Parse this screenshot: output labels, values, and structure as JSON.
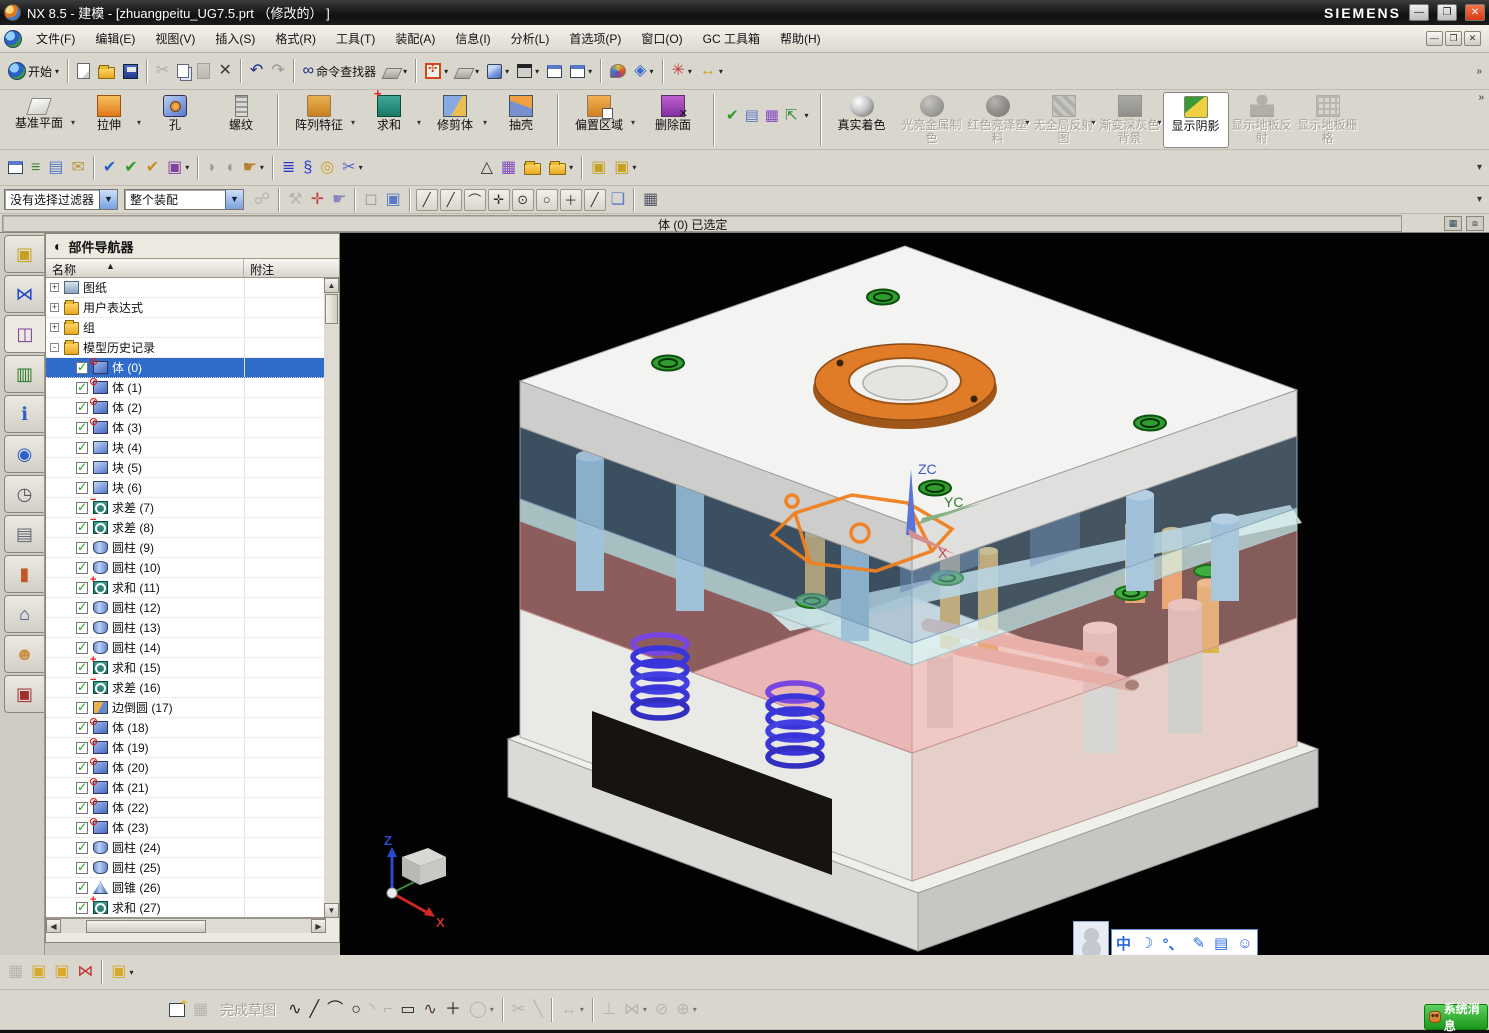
{
  "window": {
    "title": "NX 8.5 - 建模 - [zhuangpeitu_UG7.5.prt （修改的） ]",
    "brand": "SIEMENS",
    "minimize": "—",
    "maximize": "❐",
    "close": "✕"
  },
  "menubar": {
    "items": [
      "文件(F)",
      "编辑(E)",
      "视图(V)",
      "插入(S)",
      "格式(R)",
      "工具(T)",
      "装配(A)",
      "信息(I)",
      "分析(L)",
      "首选项(P)",
      "窗口(O)",
      "GC 工具箱",
      "帮助(H)"
    ],
    "win_controls": [
      "—",
      "❐",
      "✕"
    ]
  },
  "toolbar_standard": {
    "icons": [
      {
        "n": "start-button",
        "t": "开始",
        "cls": "i-nx",
        "dd": 1
      },
      "|",
      {
        "n": "new-file",
        "cls": "i-page"
      },
      {
        "n": "open-file",
        "cls": "i-folderL"
      },
      {
        "n": "save",
        "cls": "i-disk"
      },
      "|",
      {
        "n": "cut",
        "g": "✂",
        "c": "#8a8a86",
        "d": 1
      },
      {
        "n": "copy",
        "cls": "i-copy"
      },
      {
        "n": "paste",
        "cls": "i-paste",
        "d": 1
      },
      {
        "n": "delete",
        "g": "✕",
        "c": "#3a3a3a"
      },
      "|",
      {
        "n": "undo",
        "g": "↶",
        "c": "#1c2f8c"
      },
      {
        "n": "redo",
        "g": "↷",
        "c": "#9a9a96"
      },
      "|",
      {
        "n": "command-finder",
        "t": "命令查找器",
        "g": "∞",
        "c": "#1c2f8c"
      },
      {
        "n": "touch-window",
        "cls": "i-laptop",
        "dd": 1
      },
      "|",
      {
        "n": "fit-view",
        "cls": "i-fit",
        "dd": 1
      },
      {
        "n": "window-display",
        "cls": "i-laptop",
        "dd": 1
      },
      {
        "n": "shaded-view",
        "cls": "i-cube",
        "dd": 1
      },
      {
        "n": "view-background",
        "cls": "i-bg",
        "dd": 1
      },
      {
        "n": "restore-window",
        "cls": "i-win"
      },
      {
        "n": "new-view-window",
        "cls": "i-win",
        "dd": 1
      },
      "|",
      {
        "n": "role-palette",
        "cls": "i-pal"
      },
      {
        "n": "synchronize",
        "g": "◈",
        "c": "#3a6ad0",
        "dd": 1
      },
      "|",
      {
        "n": "assembly-constraint-pins",
        "g": "✳",
        "c": "#c04040",
        "dd": 1
      },
      {
        "n": "measure-distance",
        "g": "↔",
        "c": "#c8a020",
        "dd": 1
      }
    ]
  },
  "toolbar_feature": {
    "buttons": [
      {
        "n": "datum-plane",
        "label": "基准平面",
        "icon": "fi-plane",
        "dd": 1,
        "w": 1
      },
      {
        "n": "extrude",
        "label": "拉伸",
        "icon": "fi-extrude",
        "dd": 1
      },
      {
        "n": "hole",
        "label": "孔",
        "icon": "fi-hole"
      },
      {
        "n": "thread",
        "label": "螺纹",
        "icon": "fi-thread"
      },
      "|",
      {
        "n": "pattern-feature",
        "label": "阵列特征",
        "icon": "fi-pattern",
        "dd": 1,
        "w": 1
      },
      {
        "n": "unite",
        "label": "求和",
        "icon": "fi-unite",
        "dd": 1
      },
      {
        "n": "trim-body",
        "label": "修剪体",
        "icon": "fi-trim",
        "dd": 1
      },
      {
        "n": "shell",
        "label": "抽壳",
        "icon": "fi-shell"
      },
      "|",
      {
        "n": "offset-region",
        "label": "偏置区域",
        "icon": "fi-offset",
        "dd": 1,
        "w": 1
      },
      {
        "n": "delete-face",
        "label": "删除面",
        "icon": "fi-delface",
        "w": 1
      },
      "|",
      "minis",
      "|",
      {
        "n": "true-shading",
        "label": "真实着色",
        "icon": "fi-sphere",
        "w": 1
      },
      {
        "n": "shiny-metal",
        "label": "光亮金属制色",
        "icon": "fi-sphere dk",
        "dis": 1
      },
      {
        "n": "red-glossy-plastic",
        "label": "红色亮泽塑料",
        "icon": "fi-sphere rd",
        "dis": 1,
        "dd": 1
      },
      {
        "n": "no-global-reflection",
        "label": "无全局反射图",
        "icon": "fi-checker",
        "dis": 1,
        "dd": 1
      },
      {
        "n": "gradient-gray-background",
        "label": "渐变深灰色背景",
        "icon": "fi-dark",
        "dis": 1,
        "dd": 1
      },
      {
        "n": "show-shadows",
        "label": "显示阴影",
        "icon": "fi-lamp",
        "on": 1
      },
      {
        "n": "show-floor-reflection",
        "label": "显示地板反射",
        "icon": "fi-person",
        "dis": 1
      },
      {
        "n": "show-floor-grid",
        "label": "显示地板栅格",
        "icon": "fi-grid",
        "dis": 1
      }
    ],
    "mini_icons": [
      {
        "n": "examine-geometry",
        "g": "✔",
        "c": "#2a9a2a"
      },
      {
        "n": "feature-checklist",
        "g": "▤",
        "c": "#5878c8"
      },
      {
        "n": "deviation-gauge",
        "g": "▦",
        "c": "#8048c0"
      },
      {
        "n": "reference-axes",
        "g": "⇱",
        "c": "#3a8a3a"
      }
    ]
  },
  "toolbar_tools": {
    "icons": [
      {
        "n": "view-section-box",
        "cls": "i-win"
      },
      {
        "n": "layer-visible",
        "g": "≡",
        "c": "#3a8a3a"
      },
      {
        "n": "layer-settings",
        "g": "▤",
        "c": "#5878c8"
      },
      {
        "n": "note-tag",
        "g": "✉",
        "c": "#b89a40"
      },
      "|",
      {
        "n": "check-body",
        "g": "✔",
        "c": "#2a62c8"
      },
      {
        "n": "check-tool",
        "g": "✔",
        "c": "#2a9a2a"
      },
      {
        "n": "check-region",
        "g": "✔",
        "c": "#c89020"
      },
      {
        "n": "annotation-abc",
        "g": "▣",
        "c": "#8040a0",
        "dd": 1
      },
      "|",
      {
        "n": "swept-gray",
        "g": "◗",
        "c": "#9a9a96"
      },
      {
        "n": "revolve-gray",
        "g": "◖",
        "c": "#9a9a96"
      },
      {
        "n": "select-list-hand",
        "g": "☛",
        "c": "#b88030",
        "dd": 1
      },
      "|",
      {
        "n": "coil",
        "g": "≣",
        "c": "#2a3ac8"
      },
      {
        "n": "spring",
        "g": "§",
        "c": "#2a3ac8"
      },
      {
        "n": "washer",
        "g": "◎",
        "c": "#c8a020"
      },
      {
        "n": "cut-spring",
        "g": "✂",
        "c": "#5868c8",
        "dd": 1
      },
      "gap",
      {
        "n": "triangle-tolerance",
        "g": "△",
        "c": "#333333"
      },
      {
        "n": "part-family-table",
        "g": "▦",
        "c": "#8048c0"
      },
      {
        "n": "folder-points",
        "cls": "i-folderL"
      },
      {
        "n": "folder-circles",
        "cls": "i-folderL",
        "dd": 1
      },
      "|",
      {
        "n": "wave-linker",
        "g": "▣",
        "c": "#c8a020"
      },
      {
        "n": "wave-geometry",
        "g": "▣",
        "c": "#c8a020",
        "dd": 1
      }
    ]
  },
  "selection_bar": {
    "filter_value": "没有选择过滤器",
    "scope_value": "整个装配",
    "mid_icons": [
      {
        "n": "select-handles",
        "g": "☍",
        "c": "#9a9a96",
        "d": 1
      },
      "|",
      {
        "n": "general-selection",
        "g": "⚒",
        "c": "#9a9a96",
        "d": 1
      },
      {
        "n": "snap-target",
        "g": "✛",
        "c": "#c04040"
      },
      {
        "n": "pick-hand",
        "g": "☛",
        "c": "#8a86c0"
      },
      "|",
      {
        "n": "eraser",
        "g": "◻",
        "c": "#9a9a96"
      },
      {
        "n": "select-box",
        "g": "▣",
        "c": "#5878c8"
      },
      "|"
    ],
    "snap_points": [
      {
        "n": "snap-endpoint",
        "g": "╱"
      },
      {
        "n": "snap-midpoint",
        "g": "╱"
      },
      {
        "n": "snap-control-point",
        "g": "⌒"
      },
      {
        "n": "snap-intersection",
        "g": "✛"
      },
      {
        "n": "snap-arc-center",
        "g": "⊙"
      },
      {
        "n": "snap-quadrant",
        "g": "○"
      },
      {
        "n": "snap-existing-point",
        "g": "＋"
      },
      {
        "n": "snap-point-on-curve",
        "g": "╱"
      }
    ],
    "tail_icons": [
      {
        "n": "snap-point-on-face",
        "g": "❏",
        "c": "#5878c8"
      },
      "|",
      {
        "n": "grid-snap",
        "g": "▦",
        "c": "#556"
      }
    ]
  },
  "prompt": {
    "text": "体 (0) 已选定"
  },
  "navigator": {
    "title": "部件导航器",
    "title_icon": "◐",
    "columns": {
      "name": "名称",
      "note": "附注",
      "sort": "▲"
    },
    "rows": [
      {
        "label": "图纸",
        "type": "drawing",
        "expander": "+"
      },
      {
        "label": "用户表达式",
        "type": "folder",
        "expander": "+"
      },
      {
        "label": "组",
        "type": "folder",
        "expander": "+"
      },
      {
        "label": "模型历史记录",
        "type": "folder-open",
        "expander": "-"
      },
      {
        "label": "体 (0)",
        "type": "body",
        "checked": true,
        "selected": true
      },
      {
        "label": "体 (1)",
        "type": "body",
        "checked": true
      },
      {
        "label": "体 (2)",
        "type": "body",
        "checked": true
      },
      {
        "label": "体 (3)",
        "type": "body",
        "checked": true
      },
      {
        "label": "块 (4)",
        "type": "block",
        "checked": true
      },
      {
        "label": "块 (5)",
        "type": "block",
        "checked": true
      },
      {
        "label": "块 (6)",
        "type": "block",
        "checked": true
      },
      {
        "label": "求差 (7)",
        "type": "subtract",
        "checked": true
      },
      {
        "label": "求差 (8)",
        "type": "subtract",
        "checked": true
      },
      {
        "label": "圆柱 (9)",
        "type": "cylinder",
        "checked": true
      },
      {
        "label": "圆柱 (10)",
        "type": "cylinder",
        "checked": true
      },
      {
        "label": "求和 (11)",
        "type": "unite",
        "checked": true
      },
      {
        "label": "圆柱 (12)",
        "type": "cylinder",
        "checked": true
      },
      {
        "label": "圆柱 (13)",
        "type": "cylinder",
        "checked": true
      },
      {
        "label": "圆柱 (14)",
        "type": "cylinder",
        "checked": true
      },
      {
        "label": "求和 (15)",
        "type": "unite",
        "checked": true
      },
      {
        "label": "求差 (16)",
        "type": "subtract",
        "checked": true
      },
      {
        "label": "边倒圆 (17)",
        "type": "blend",
        "checked": true
      },
      {
        "label": "体 (18)",
        "type": "body",
        "checked": true
      },
      {
        "label": "体 (19)",
        "type": "body",
        "checked": true
      },
      {
        "label": "体 (20)",
        "type": "body",
        "checked": true
      },
      {
        "label": "体 (21)",
        "type": "body",
        "checked": true
      },
      {
        "label": "体 (22)",
        "type": "body",
        "checked": true
      },
      {
        "label": "体 (23)",
        "type": "body",
        "checked": true
      },
      {
        "label": "圆柱 (24)",
        "type": "cylinder",
        "checked": true
      },
      {
        "label": "圆柱 (25)",
        "type": "cylinder",
        "checked": true
      },
      {
        "label": "圆锥 (26)",
        "type": "cone",
        "checked": true
      },
      {
        "label": "求和 (27)",
        "type": "unite",
        "checked": true
      }
    ]
  },
  "resource_bar": {
    "tabs": [
      {
        "n": "assembly-navigator-tab",
        "g": "▣",
        "c": "#c8a020"
      },
      {
        "n": "constraint-navigator-tab",
        "g": "⋈",
        "c": "#2244cc"
      },
      {
        "n": "part-navigator-tab",
        "g": "◫",
        "c": "#8040a0",
        "on": 1
      },
      {
        "n": "reuse-library-tab",
        "g": "▥",
        "c": "#2a7a2a"
      },
      {
        "n": "hd3d-tools-tab",
        "g": "ℹ",
        "c": "#2a62c8"
      },
      {
        "n": "web-browser-tab",
        "g": "◉",
        "c": "#2a62c8"
      },
      {
        "n": "history-tab",
        "g": "◷",
        "c": "#556"
      },
      {
        "n": "process-studio-tab",
        "g": "▤",
        "c": "#667"
      },
      {
        "n": "machining-wizard-tab",
        "g": "▮",
        "c": "#c05828"
      },
      {
        "n": "templates-tab",
        "g": "⌂",
        "c": "#334a88"
      },
      {
        "n": "roles-tab",
        "g": "☻",
        "c": "#c89040"
      },
      {
        "n": "palettes-tab",
        "g": "▣",
        "c": "#a03030"
      }
    ]
  },
  "viewport": {
    "wcs": {
      "z": "ZC",
      "y": "YC",
      "x": "X"
    },
    "triad": {
      "z": "Z",
      "x": "X"
    },
    "ime_items": [
      "中",
      "☽",
      "°、",
      "✎",
      "▤",
      "☺"
    ]
  },
  "toolbar_assembly": {
    "icons": [
      {
        "n": "find-component",
        "g": "▦",
        "c": "#9a9a96",
        "d": 1
      },
      {
        "n": "add-component",
        "g": "▣",
        "c": "#d8a828"
      },
      {
        "n": "move-component",
        "g": "▣",
        "c": "#d8a828"
      },
      {
        "n": "assembly-constraints",
        "g": "⋈",
        "c": "#c03030"
      },
      "|",
      {
        "n": "pattern-component",
        "g": "▣",
        "c": "#d8a828",
        "dd": 1
      }
    ]
  },
  "toolbar_sketch": {
    "finish_label": "完成草图",
    "lead_icons": [
      {
        "n": "sketch-in-task",
        "cls": "i-sketch"
      },
      {
        "n": "sketch-reattach",
        "g": "▦",
        "c": "#9a9a96",
        "d": 1
      }
    ],
    "icons": [
      {
        "n": "profile",
        "g": "∿",
        "c": "#222222"
      },
      {
        "n": "line",
        "g": "╱",
        "c": "#222222"
      },
      {
        "n": "arc",
        "g": "⌒",
        "c": "#222222"
      },
      {
        "n": "circle",
        "g": "○",
        "c": "#222222"
      },
      {
        "n": "fillet",
        "g": "◝",
        "c": "#9a9a96",
        "d": 1
      },
      {
        "n": "chamfer",
        "g": "⌐",
        "c": "#9a9a96",
        "d": 1
      },
      {
        "n": "rectangle",
        "g": "▭",
        "c": "#222222"
      },
      {
        "n": "studio-spline",
        "g": "∿",
        "c": "#553333"
      },
      {
        "n": "point",
        "g": "＋",
        "c": "#222222"
      },
      {
        "n": "ellipse",
        "g": "◯",
        "c": "#9a9a96",
        "d": 1,
        "dd": 1
      },
      "|",
      {
        "n": "quick-trim",
        "g": "✂",
        "c": "#9a9a96",
        "d": 1
      },
      {
        "n": "quick-extend",
        "g": "╲",
        "c": "#9a9a96",
        "d": 1
      },
      "|",
      {
        "n": "rapid-dimension",
        "g": "↔",
        "c": "#9a9a96",
        "d": 1,
        "dd": 1
      },
      "|",
      {
        "n": "geometric-constraints",
        "g": "⊥",
        "c": "#9a9a96",
        "d": 1
      },
      {
        "n": "make-symmetric",
        "g": "⋈",
        "c": "#9a9a96",
        "d": 1,
        "dd": 1
      },
      {
        "n": "display-constraints",
        "g": "⊘",
        "c": "#9a9a96",
        "d": 1
      },
      {
        "n": "auto-constrain",
        "g": "⊕",
        "c": "#9a9a96",
        "d": 1,
        "dd": 1
      }
    ]
  },
  "notification": {
    "label": "系统消息"
  }
}
